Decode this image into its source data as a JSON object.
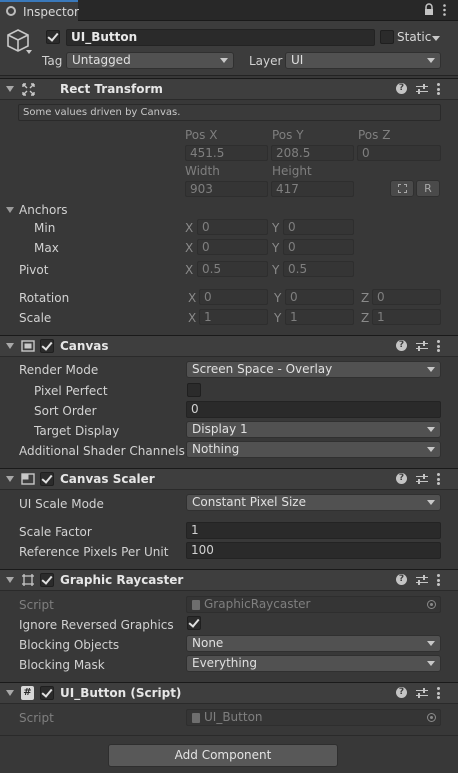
{
  "tab": {
    "label": "Inspector"
  },
  "object": {
    "name": "UI_Button",
    "active": true,
    "static_label": "Static",
    "tag_label": "Tag",
    "tag_value": "Untagged",
    "layer_label": "Layer",
    "layer_value": "UI"
  },
  "rect_transform": {
    "title": "Rect Transform",
    "notice": "Some values driven by Canvas.",
    "pos_x_label": "Pos X",
    "pos_y_label": "Pos Y",
    "pos_z_label": "Pos Z",
    "pos_x": "451.5",
    "pos_y": "208.5",
    "pos_z": "0",
    "width_label": "Width",
    "height_label": "Height",
    "width": "903",
    "height": "417",
    "r_button": "R",
    "anchors_label": "Anchors",
    "min_label": "Min",
    "max_label": "Max",
    "min_x": "0",
    "min_y": "0",
    "max_x": "0",
    "max_y": "0",
    "pivot_label": "Pivot",
    "pivot_x": "0.5",
    "pivot_y": "0.5",
    "rotation_label": "Rotation",
    "rot_x": "0",
    "rot_y": "0",
    "rot_z": "0",
    "scale_label": "Scale",
    "scale_x": "1",
    "scale_y": "1",
    "scale_z": "1",
    "axis_x": "X",
    "axis_y": "Y",
    "axis_z": "Z"
  },
  "canvas": {
    "title": "Canvas",
    "render_mode_label": "Render Mode",
    "render_mode": "Screen Space - Overlay",
    "pixel_perfect_label": "Pixel Perfect",
    "sort_order_label": "Sort Order",
    "sort_order": "0",
    "target_display_label": "Target Display",
    "target_display": "Display 1",
    "shader_channels_label": "Additional Shader Channels",
    "shader_channels": "Nothing"
  },
  "canvas_scaler": {
    "title": "Canvas Scaler",
    "ui_scale_mode_label": "UI Scale Mode",
    "ui_scale_mode": "Constant Pixel Size",
    "scale_factor_label": "Scale Factor",
    "scale_factor": "1",
    "ref_ppu_label": "Reference Pixels Per Unit",
    "ref_ppu": "100"
  },
  "graphic_raycaster": {
    "title": "Graphic Raycaster",
    "script_label": "Script",
    "script_value": "GraphicRaycaster",
    "ignore_reversed_label": "Ignore Reversed Graphics",
    "blocking_objects_label": "Blocking Objects",
    "blocking_objects": "None",
    "blocking_mask_label": "Blocking Mask",
    "blocking_mask": "Everything"
  },
  "ui_button_script": {
    "title": "UI_Button (Script)",
    "script_label": "Script",
    "script_value": "UI_Button"
  },
  "add_component": {
    "label": "Add Component"
  },
  "colors": {
    "background": "#383838",
    "header": "#3e3e3e",
    "field": "#2a2a2a",
    "dropdown": "#515151",
    "text": "#d2d2d2"
  },
  "icons": [
    "lock-icon",
    "kebab-icon",
    "cube-icon",
    "rect-transform-icon",
    "canvas-icon",
    "canvas-scaler-icon",
    "raycaster-icon",
    "script-icon",
    "help-icon",
    "preset-icon",
    "blueprint-icon",
    "raw-edit-icon",
    "object-picker-icon"
  ]
}
